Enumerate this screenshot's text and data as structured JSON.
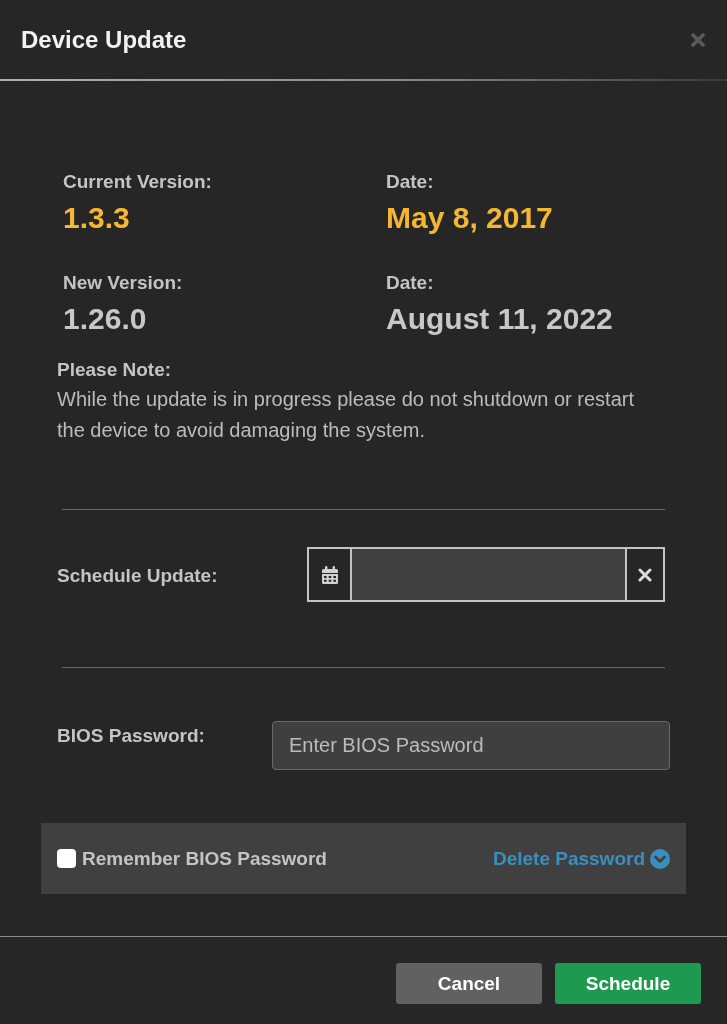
{
  "window": {
    "title": "Device Update"
  },
  "versions": [
    {
      "kind": "current",
      "label": "Current Version:",
      "value": "1.3.3",
      "date_label": "Date:",
      "date": "May 8, 2017"
    },
    {
      "kind": "new",
      "label": "New Version:",
      "value": "1.26.0",
      "date_label": "Date:",
      "date": "August 11, 2022"
    }
  ],
  "note": {
    "title": "Please Note:",
    "text": "While the update is in progress please do not shutdown or restart the device to avoid damaging the system."
  },
  "schedule": {
    "label": "Schedule Update:"
  },
  "bios_password": {
    "label": "BIOS Password:",
    "placeholder": "Enter BIOS Password"
  },
  "remember": {
    "label": "Remember BIOS Password",
    "checked": false
  },
  "delete_link": {
    "label": "Delete Password"
  },
  "buttons": [
    {
      "kind": "secondary",
      "label": "Cancel"
    },
    {
      "kind": "primary",
      "label": "Schedule"
    }
  ]
}
